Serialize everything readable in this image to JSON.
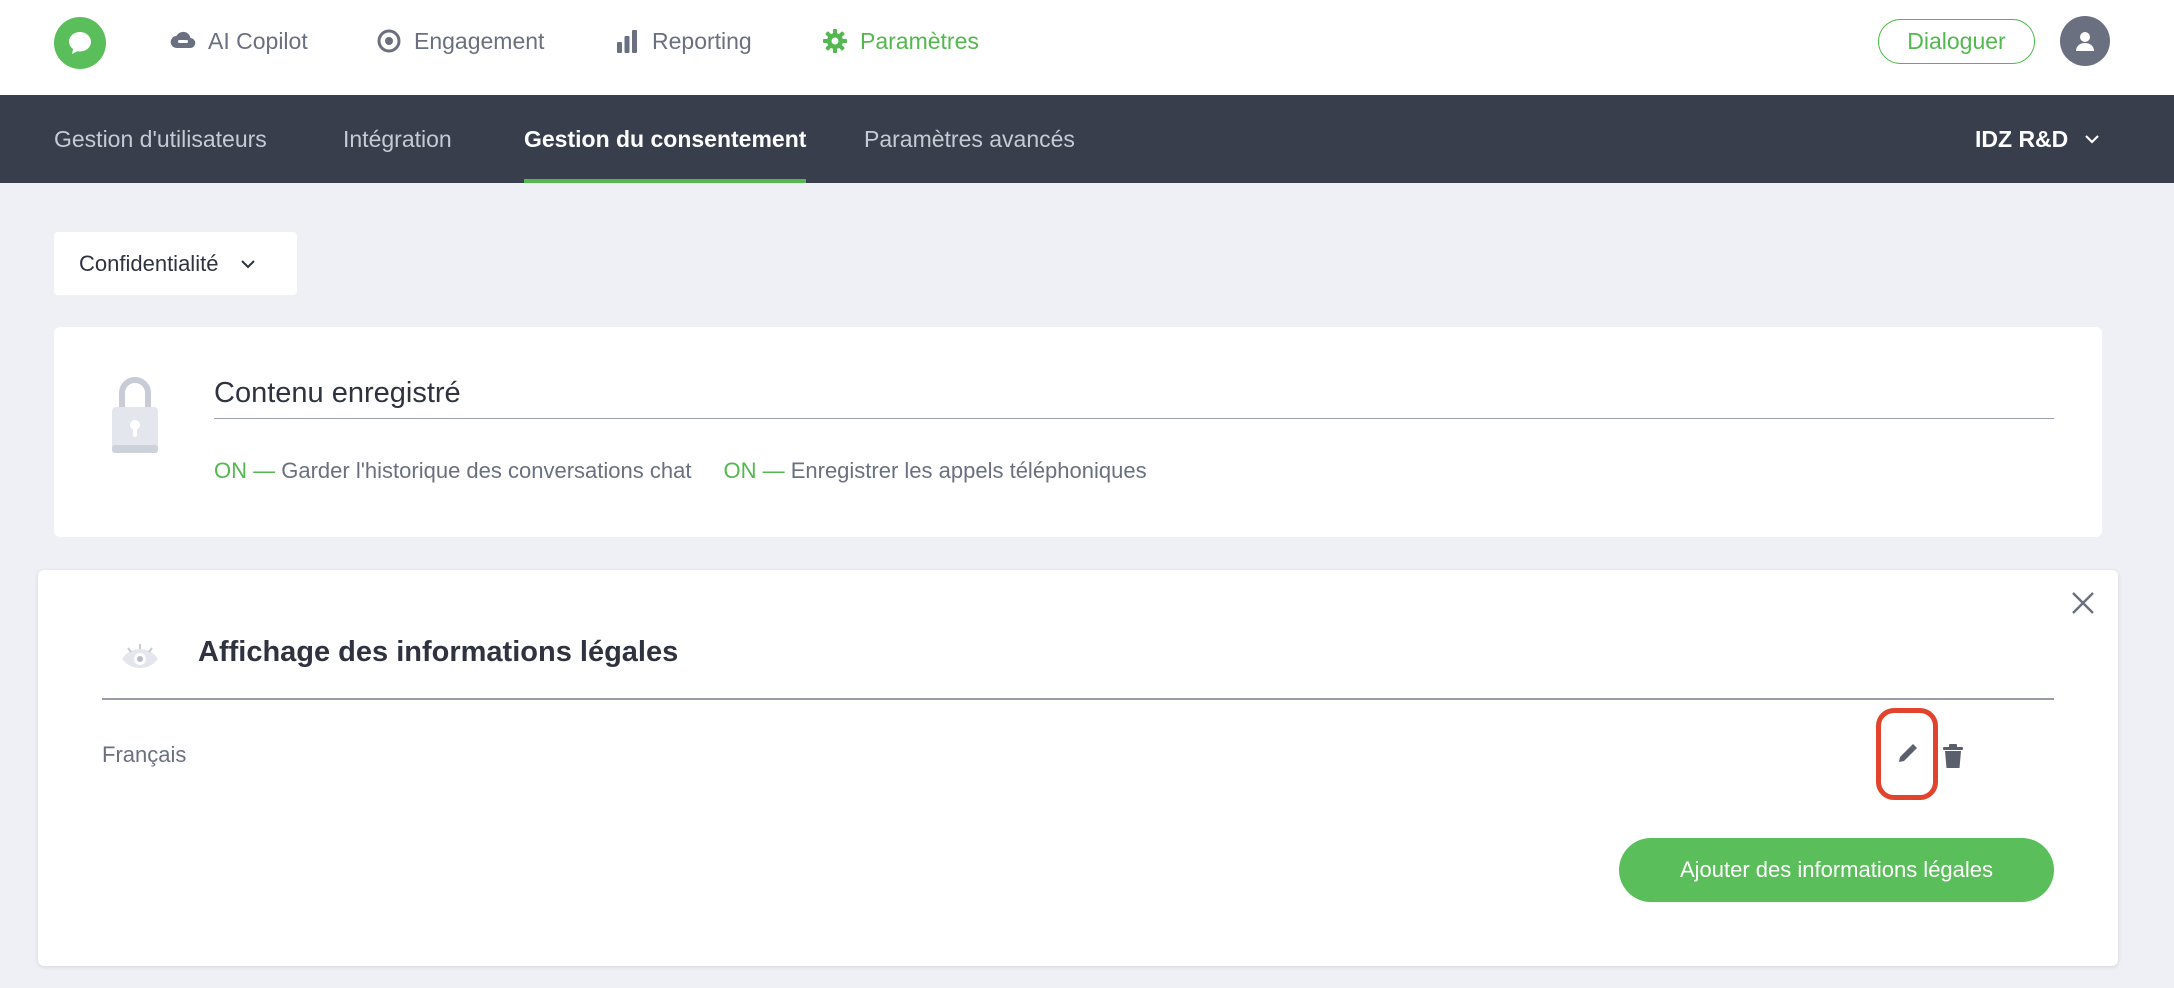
{
  "topbar": {
    "nav": [
      {
        "label": "AI Copilot",
        "icon": "cloud-icon"
      },
      {
        "label": "Engagement",
        "icon": "target-icon"
      },
      {
        "label": "Reporting",
        "icon": "bar-chart-icon"
      },
      {
        "label": "Paramètres",
        "icon": "gear-icon",
        "active": true
      }
    ],
    "dialog_button": "Dialoguer",
    "avatar_icon": "user-icon"
  },
  "subnav": {
    "tabs": [
      {
        "label": "Gestion d'utilisateurs"
      },
      {
        "label": "Intégration"
      },
      {
        "label": "Gestion du consentement",
        "active": true
      },
      {
        "label": "Paramètres avancés"
      }
    ],
    "org_label": "IDZ R&D"
  },
  "filter": {
    "selected": "Confidentialité"
  },
  "recorded_content": {
    "title": "Contenu enregistré",
    "items": [
      {
        "state": "ON —",
        "label": "Garder l'historique des conversations chat"
      },
      {
        "state": "ON —",
        "label": "Enregistrer les appels téléphoniques"
      }
    ]
  },
  "legal_display": {
    "title": "Affichage des informations légales",
    "rows": [
      {
        "language": "Français"
      }
    ],
    "add_button": "Ajouter des informations légales"
  },
  "colors": {
    "accent": "#52b84f",
    "nav_bg": "#383e4c",
    "page_bg": "#eef0f5",
    "highlight": "#e2432d"
  }
}
